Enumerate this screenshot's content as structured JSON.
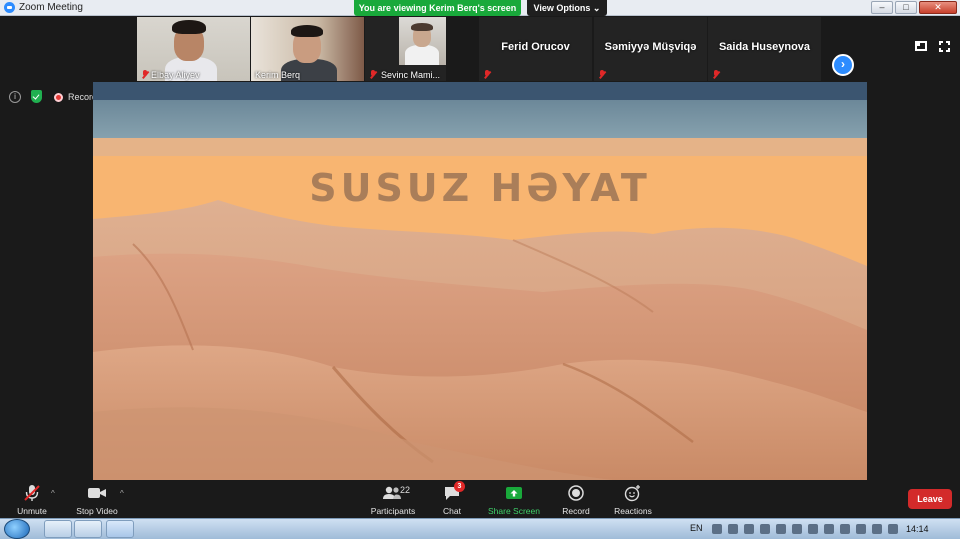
{
  "window": {
    "title": "Zoom Meeting",
    "share_banner": "You are viewing Kerim Berq's screen",
    "view_options": "View Options",
    "controls": [
      "minimize",
      "maximize",
      "close"
    ]
  },
  "participants": [
    {
      "name": "Elbay Aliyev",
      "muted": true,
      "video": true
    },
    {
      "name": "Kerim Berq",
      "muted": false,
      "video": true
    },
    {
      "name": "Sevinc Mami...",
      "muted": true,
      "video": true
    },
    {
      "name": "Ferid Orucov",
      "muted": true,
      "video": false
    },
    {
      "name": "Səmiyyə Müşviqə",
      "muted": true,
      "video": false
    },
    {
      "name": "Saida Huseynova",
      "muted": true,
      "video": false
    }
  ],
  "status": {
    "recording_label": "Recording"
  },
  "shared_screen": {
    "slide_title": "SUSUZ HƏYAT",
    "colors": {
      "sky_dark": "#3b5570",
      "sky_mid": "#7c97a6",
      "sand_band": "#e5b388",
      "background": "#f8b571",
      "dune_light": "#d9a07c",
      "dune_dark": "#b87854"
    }
  },
  "toolbar": {
    "unmute": "Unmute",
    "stop_video": "Stop Video",
    "participants": "Participants",
    "participants_count": "22",
    "chat": "Chat",
    "chat_badge": "3",
    "share_screen": "Share Screen",
    "record": "Record",
    "reactions": "Reactions",
    "leave": "Leave"
  },
  "taskbar": {
    "language": "EN",
    "time": "14:14"
  },
  "icons": [
    "zoom-app-icon",
    "info-icon",
    "security-shield-icon",
    "recording-icon",
    "microphone-muted-icon",
    "video-camera-icon",
    "participants-icon",
    "chat-icon",
    "share-screen-icon",
    "record-icon",
    "reactions-icon",
    "next-page-icon",
    "gallery-layout-icon",
    "fullscreen-icon"
  ]
}
